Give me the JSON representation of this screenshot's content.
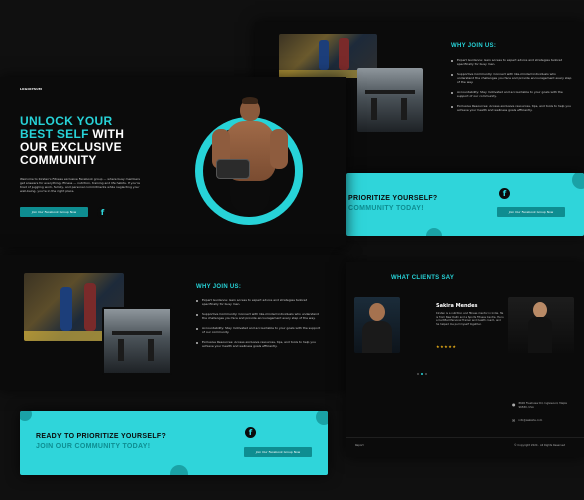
{
  "brand": {
    "logo": "LOGOIPSUM"
  },
  "hero": {
    "title_line1": "UNLOCK YOUR",
    "title_line2a": "BEST SELF",
    "title_line2b": " WITH",
    "title_line3": "OUR EXCLUSIVE",
    "title_line4": "COMMUNITY",
    "body": "Welcome to Kirsten's Fitness exclusive Facebook group — where busy members get answers for everything, fitness — nutrition, training and life habits. If you're tired of juggling work, family, and personal commitments while neglecting your well-being, you're in the right place.",
    "button": "Join Our Facebook Group Now"
  },
  "why": {
    "title": "WHY JOIN US:",
    "items": [
      "Expert Guidance: Gain access to expert advice and strategies tailored specifically for busy men.",
      "Supportive Community: Connect with like-minded individuals who understand the challenges you face and provide encouragement every step of the way.",
      "Accountability: Stay motivated and accountable to your goals with the support of our community.",
      "Exclusive Resources: Access exclusive resources, tips, and tools to help you achieve your health and wellness goals efficiently."
    ]
  },
  "cta": {
    "line1": "READY TO PRIORITIZE YOURSELF?",
    "line2": "JOIN OUR COMMUNITY TODAY!",
    "line1_cut": "PRIORITIZE YOURSELF?",
    "line2_cut": "COMMUNITY TODAY!",
    "button": "Join Our Facebook Group Now",
    "fb_glyph": "f"
  },
  "clients": {
    "title": "WHAT CLIENTS SAY",
    "name": "Sakira Mendes",
    "quote": "Kirsten is a nutrition and fitness mentor in India. He is from New Delhi and a Sports Fitness Centre. He is a Certified Personal Trainer and health coach, and he helped me pull myself together.",
    "stars": "★★★★★"
  },
  "footer": {
    "address": "8600 Fleetview Rd, Inglewood, Maple 96580, USA",
    "email": "info@website.com",
    "left": "Report",
    "copyright": "© Copyright 2024 . All Rights Reserved"
  },
  "icons": {
    "location": "location-pin-icon",
    "mail": "mail-icon",
    "facebook": "facebook-icon"
  },
  "colors": {
    "accent": "#27d3d8",
    "button": "#0e8d91",
    "cta_bg": "#2fd5da"
  }
}
